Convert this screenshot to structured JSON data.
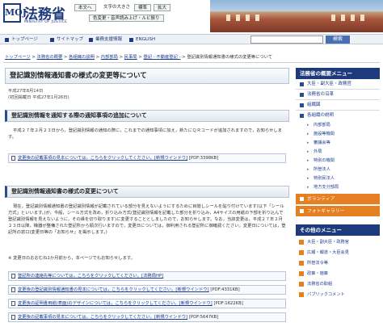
{
  "header": {
    "logo_mark": "MOJ",
    "site_title": "法務省",
    "site_subtitle": "MINISTRY OF JUSTICE",
    "buttons": [
      "本文へ",
      "文字の大きさ",
      "標準",
      "拡大"
    ],
    "color_button": "色変更・音声読み上げ・ルビ振り"
  },
  "nav": {
    "items": [
      "トップページ",
      "サイトマップ",
      "業務支援情報",
      "ENGLISH"
    ],
    "search_placeholder": "",
    "search_button": "検索"
  },
  "breadcrumb": {
    "items": [
      "トップページ",
      "法務省の概要",
      "各組織の説明",
      "内部部局",
      "民事局",
      "登記 - 不動産登記 -"
    ],
    "current": "登記識別情報通知書の様式の変更等について",
    "separator": ">"
  },
  "main": {
    "title": "登記識別情報通知書の様式の変更等について",
    "date_posted": "平成27年8月14日",
    "date_initial": "(初回掲載日 平成27年1月26日)",
    "section1_title": "登記識別情報を通知する際の通知事項の追加について",
    "section1_text": "平成２７年２月２３日から，登記識別情報の通知の際に，これまでの通知事項に加え，新たにＱＲコードが追加されますので，お知らせします。",
    "link1_text": "変更後の記載事項の見本については，こちらをクリックしてください。[新規ウインドウ]",
    "link1_size": "[PDF:3398KB]",
    "section2_title": "登記識別情報通知書の様式の変更について",
    "section2_text": "現在，登記識別情報通知書の登記識別情報が記載されている部分を見えないようにするために目隠しシールを貼り付けています(以下「シール方式」といいます。)が，今般，シール方式を改め，折り込み方式(登記識別情報を記載した部分を折り込み，A4サイズの用紙の下部を折り込んで登記識別情報を見えないように，その縁を切り取ります)に変更することとしましたので，お知らせします。なお，当該変更は，平成２７年２月２３日以降，機器が整備された登記所から順次行いますので，変更日については，御利用される登記所に御確認ください。変更日については，登記所の窓口(変更日等の「お知らせ」を掲示します。)",
    "section2_note": "※ 変更日のおおむね1か月前から，本ページでもお知らせします。",
    "links": [
      {
        "text": "登記所の連絡先等については，こちらをクリックしてください。[法務局HP]",
        "size": ""
      },
      {
        "text": "変更後の登記識別情報通知書の見本については，こちらをクリックしてください。[新規ウインドウ]",
        "size": "[PDF:4331KB]"
      },
      {
        "text": "変更後の証明書用紙(表面)のデザインについては，こちらをクリックしてください。[新規ウインドウ]",
        "size": "[PDF:1622KB]"
      },
      {
        "text": "変更後の記載事項の見本については，こちらをクリックしてください。[新規ウインドウ]",
        "size": "[PDF:5647KB]"
      }
    ]
  },
  "sidebar": {
    "menu_title": "法務省の概要メニュー",
    "items": [
      "大臣・副大臣・政務官",
      "法務省の沿革",
      "組織図",
      "各組織の説明"
    ],
    "subitems": [
      "内部部局",
      "施設等機関",
      "審議会等",
      "外局",
      "特別の機関",
      "所管法人",
      "特別民法人",
      "地方支分部局"
    ],
    "orange_items": [
      "ボランティア",
      "フォトギャラリー"
    ],
    "other_title": "その他のメニュー",
    "other_items": [
      "大臣・副大臣・政務官",
      "広報・報道・大臣会見",
      "所管法令等",
      "政策・施策",
      "法務省の取組",
      "パブリックコメント"
    ],
    "accent_color": "#1d3a7c",
    "orange_color": "#e67e22"
  }
}
